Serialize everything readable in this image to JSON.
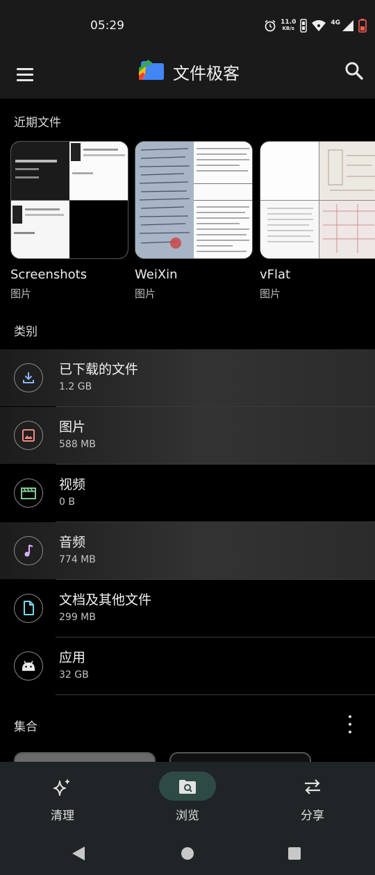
{
  "status_bar": {
    "time": "05:29",
    "net_speed_value": "11.0",
    "net_speed_unit": "KB/s",
    "network_type": "4G"
  },
  "app_bar": {
    "title": "文件极客",
    "menu_icon": "hamburger-menu-icon",
    "search_icon": "search-icon"
  },
  "recent": {
    "header": "近期文件",
    "items": [
      {
        "name": "Screenshots",
        "type": "图片"
      },
      {
        "name": "WeiXin",
        "type": "图片"
      },
      {
        "name": "vFlat",
        "type": "图片"
      }
    ]
  },
  "categories": {
    "header": "类别",
    "items": [
      {
        "title": "已下载的文件",
        "size": "1.2 GB",
        "icon": "download-icon",
        "color": "#8ab4f8"
      },
      {
        "title": "图片",
        "size": "588 MB",
        "icon": "image-icon",
        "color": "#f28b82"
      },
      {
        "title": "视频",
        "size": "0 B",
        "icon": "video-icon",
        "color": "#81c995"
      },
      {
        "title": "音频",
        "size": "774 MB",
        "icon": "music-note-icon",
        "color": "#d7aefb"
      },
      {
        "title": "文档及其他文件",
        "size": "299 MB",
        "icon": "document-icon",
        "color": "#78d9ec"
      },
      {
        "title": "应用",
        "size": "32 GB",
        "icon": "android-icon",
        "color": "#e8eaed"
      }
    ]
  },
  "collections": {
    "header": "集合",
    "more_icon": "more-vert-icon"
  },
  "bottom_nav": {
    "items": [
      {
        "label": "清理",
        "icon": "sparkle-clean-icon"
      },
      {
        "label": "浏览",
        "icon": "browse-folder-icon",
        "selected": true
      },
      {
        "label": "分享",
        "icon": "swap-share-icon"
      }
    ],
    "selected_color": "#2e4a45"
  },
  "system_nav": {
    "back_icon": "back-triangle-icon",
    "home_icon": "home-circle-icon",
    "recents_icon": "recents-square-icon"
  }
}
